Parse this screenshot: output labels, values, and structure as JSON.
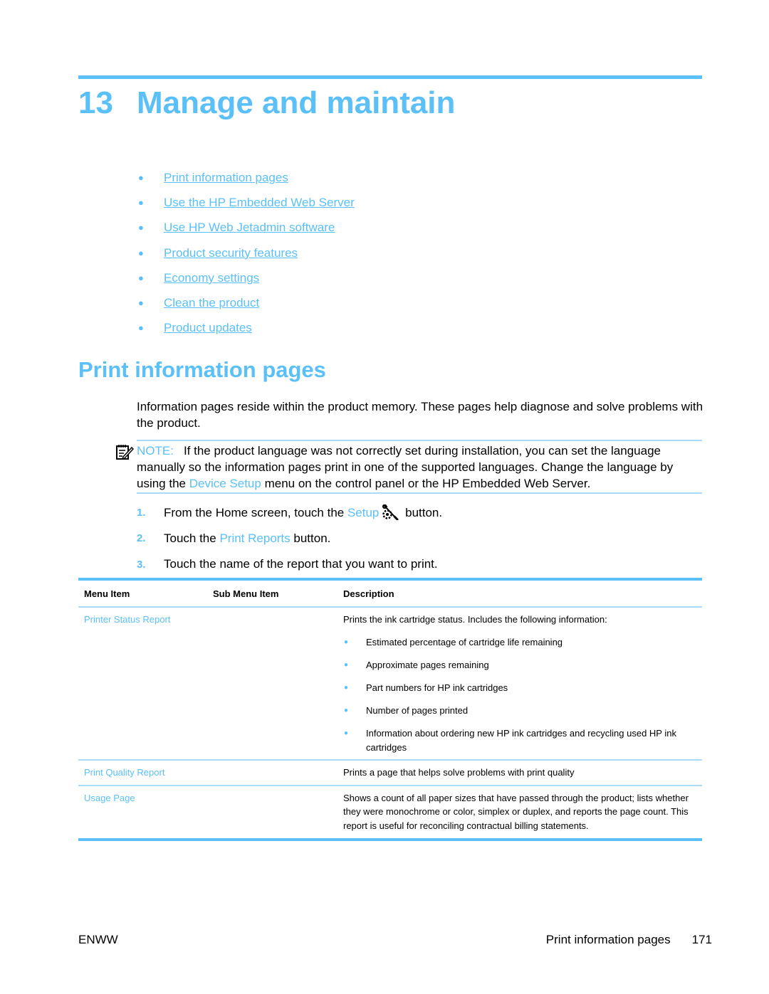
{
  "chapter": {
    "number": "13",
    "title": "Manage and maintain"
  },
  "toc": [
    {
      "label": "Print information pages"
    },
    {
      "label": "Use the HP Embedded Web Server"
    },
    {
      "label": "Use HP Web Jetadmin software"
    },
    {
      "label": "Product security features"
    },
    {
      "label": "Economy settings"
    },
    {
      "label": "Clean the product"
    },
    {
      "label": "Product updates"
    }
  ],
  "section": {
    "title": "Print information pages",
    "intro": "Information pages reside within the product memory. These pages help diagnose and solve problems with the product."
  },
  "note": {
    "label": "NOTE:",
    "text_before": "If the product language was not correctly set during installation, you can set the language manually so the information pages print in one of the supported languages. Change the language by using the ",
    "link": "Device Setup",
    "text_after": " menu on the control panel or the HP Embedded Web Server."
  },
  "steps": [
    {
      "num": "1.",
      "before": "From the Home screen, touch the ",
      "link": "Setup",
      "icon": "setup-wrench-gear-icon",
      "after": " button."
    },
    {
      "num": "2.",
      "before": "Touch the ",
      "link": "Print Reports",
      "after": " button."
    },
    {
      "num": "3.",
      "before": "Touch the name of the report that you want to print."
    }
  ],
  "table": {
    "headers": [
      "Menu Item",
      "Sub Menu Item",
      "Description"
    ],
    "rows": [
      {
        "menu_item": "Printer Status Report",
        "sub_menu_item": "",
        "description": "Prints the ink cartridge status. Includes the following information:",
        "bullets": [
          "Estimated percentage of cartridge life remaining",
          "Approximate pages remaining",
          "Part numbers for HP ink cartridges",
          "Number of pages printed",
          "Information about ordering new HP ink cartridges and recycling used HP ink cartridges"
        ]
      },
      {
        "menu_item": "Print Quality Report",
        "sub_menu_item": "",
        "description": "Prints a page that helps solve problems with print quality"
      },
      {
        "menu_item": "Usage Page",
        "sub_menu_item": "",
        "description": "Shows a count of all paper sizes that have passed through the product; lists whether they were monochrome or color, simplex or duplex, and reports the page count. This report is useful for reconciling contractual billing statements."
      }
    ]
  },
  "footer": {
    "left": "ENWW",
    "section": "Print information pages",
    "page": "171"
  },
  "colors": {
    "accent": "#5BC0F8",
    "rule_light": "#A9DBF8",
    "text": "#000000"
  }
}
